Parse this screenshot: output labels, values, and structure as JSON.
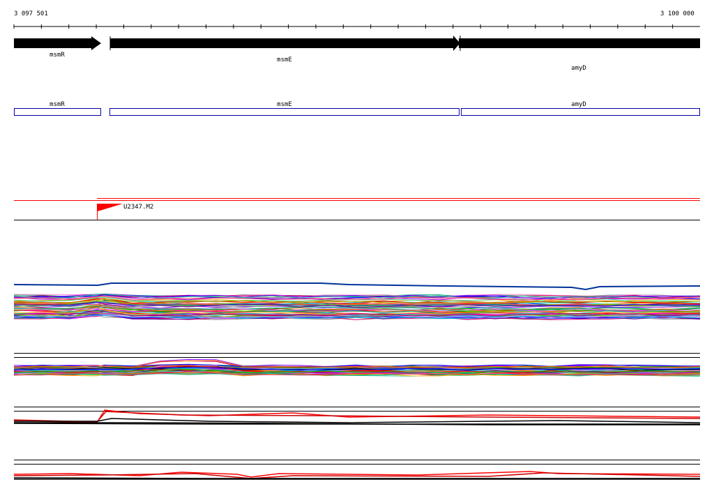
{
  "ruler": {
    "start_label": "3 097 501",
    "end_label": "3 100 000"
  },
  "genes": [
    {
      "name": "msmR"
    },
    {
      "name": "msmE"
    },
    {
      "name": "amyD"
    }
  ],
  "cds_boxes": [
    {
      "name": "msmR"
    },
    {
      "name": "msmE"
    },
    {
      "name": "amyD"
    }
  ],
  "promoter": {
    "label": "U2347.M2"
  },
  "colors": {
    "gene_arrow": "#000000",
    "cds_outline": "#0000aa",
    "promoter_red": "#ff0000",
    "track_line": "#000000"
  },
  "expression_tracks": [
    {
      "track": "multicolor-profiles-1"
    },
    {
      "track": "multicolor-profiles-2"
    },
    {
      "track": "red-black-profiles-1"
    },
    {
      "track": "red-black-profiles-2"
    }
  ]
}
